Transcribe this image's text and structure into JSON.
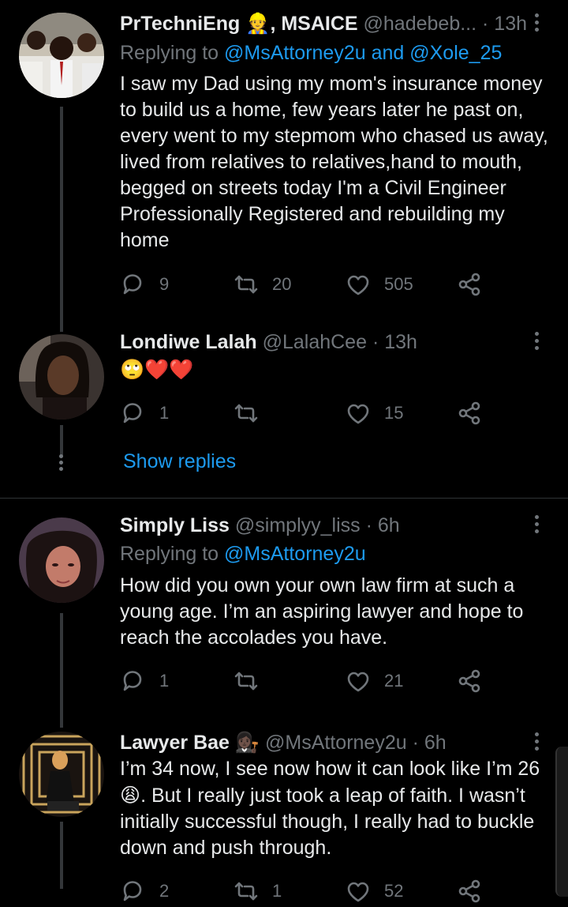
{
  "tweets": [
    {
      "name": "PrTechniEng",
      "name_emoji": "👷",
      "name_suffix": ", MSAICE",
      "handle": "@hadebeb...",
      "time": "· 13h",
      "replying_prefix": "Replying to",
      "mentions": "@MsAttorney2u and @Xole_25",
      "text": "I saw my Dad using my mom's insurance money to build us a home, few years later he past on, every went to my stepmom who chased us away, lived from relatives to relatives,hand to mouth, begged on streets today I'm a Civil Engineer Professionally Registered and rebuilding my home",
      "replies": "9",
      "retweets": "20",
      "likes": "505"
    },
    {
      "name": "Londiwe Lalah",
      "handle": "@LalahCee",
      "time": "· 13h",
      "text": "🙄❤️❤️",
      "replies": "1",
      "retweets": "",
      "likes": "15",
      "show_replies": "Show replies"
    },
    {
      "name": "Simply Liss",
      "handle": "@simplyy_liss",
      "time": "· 6h",
      "replying_prefix": "Replying to",
      "mentions": "@MsAttorney2u",
      "text": "How did you own your own law firm at such a young age. I’m an aspiring lawyer and hope to reach the accolades you have.",
      "replies": "1",
      "retweets": "",
      "likes": "21"
    },
    {
      "name": "Lawyer Bae",
      "name_emoji": "👩🏿‍⚖️",
      "handle": "@MsAttorney2u",
      "time": "· 6h",
      "text_1": "I’m 34 now, I see now how it can look like I’m 26",
      "text_emoji": "😩",
      "text_2": ". But I really just took a leap of faith. I wasn’t initially successful though, I really had to buckle down and push through.",
      "replies": "2",
      "retweets": "1",
      "likes": "52"
    }
  ],
  "icons": {
    "reply": "reply-icon",
    "retweet": "retweet-icon",
    "like": "heart-icon",
    "share": "share-icon",
    "more": "more-icon"
  },
  "colors": {
    "background": "#000000",
    "text": "#e7e9ea",
    "muted": "#71767b",
    "accent": "#1d9bf0"
  }
}
